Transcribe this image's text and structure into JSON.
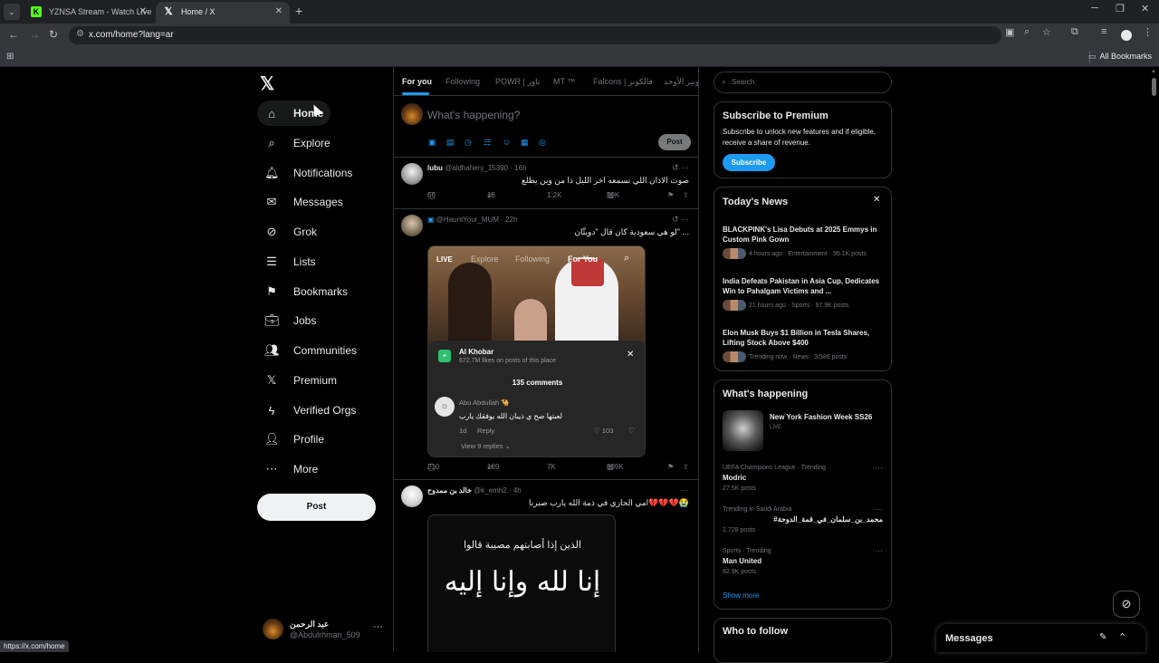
{
  "browser": {
    "tabs": [
      {
        "title": "YZNSA Stream - Watch Live on",
        "favicon": "K",
        "close": "✕"
      },
      {
        "title": "Home / X",
        "favicon": "𝕏",
        "close": "✕"
      }
    ],
    "new_tab": "+",
    "window": {
      "minimize": "─",
      "restore": "❐",
      "close": "✕"
    },
    "url": "x.com/home?lang=ar",
    "bookmarks": {
      "all_label": "All Bookmarks"
    },
    "status_url": "https://x.com/home"
  },
  "nav": {
    "logo": "𝕏",
    "items": [
      {
        "label": "Home",
        "icon": "⌂"
      },
      {
        "label": "Explore",
        "icon": "⌕"
      },
      {
        "label": "Notifications",
        "icon": "🔔︎"
      },
      {
        "label": "Messages",
        "icon": "✉"
      },
      {
        "label": "Grok",
        "icon": "⊘"
      },
      {
        "label": "Lists",
        "icon": "☰"
      },
      {
        "label": "Bookmarks",
        "icon": "⚑"
      },
      {
        "label": "Jobs",
        "icon": "💼︎"
      },
      {
        "label": "Communities",
        "icon": "👥︎"
      },
      {
        "label": "Premium",
        "icon": "𝕏"
      },
      {
        "label": "Verified Orgs",
        "icon": "ϟ"
      },
      {
        "label": "Profile",
        "icon": "👤︎"
      },
      {
        "label": "More",
        "icon": "⋯"
      }
    ],
    "post_button": "Post",
    "account": {
      "name": "عبد الرحمن",
      "handle": "@Abdulrhman_509",
      "more": "···"
    }
  },
  "timeline": {
    "tabs": [
      "For you",
      "Following",
      "POWR | باور",
      "MT ™",
      "Falcons | فالكونز",
      "بوبير الأوحد"
    ],
    "active_tab": "For you",
    "composer": {
      "placeholder": "What's happening?",
      "post_label": "Post",
      "tool_icons": [
        "▣",
        "▤",
        "◷",
        "☷",
        "☺",
        "▦",
        "◎"
      ]
    },
    "tweets": [
      {
        "name": "lubu",
        "handle": "@aldhahery_15390",
        "time": "16h",
        "text": "صوت الاذان اللي تسمعه اخر الليل ذا من وين يطلع",
        "replies": "66",
        "reposts": "13",
        "likes": "1.2K",
        "views": "59K"
      },
      {
        "name": "",
        "handle": "@HauntYour_MUM",
        "time": "22h",
        "text": "لو هي سعودية كان قال \"دويتَّان\" ...",
        "replies": "210",
        "reposts": "189",
        "likes": "7K",
        "views": "699K",
        "media": {
          "live": "LIVE",
          "tabs": [
            "Explore",
            "Following",
            "For You"
          ],
          "place": "Al Khobar",
          "place_likes": "672.7M likes on posts of this place",
          "comments_count": "135 comments",
          "comment": {
            "name": "Abu Abdullah 🐪",
            "text": "لعبتها صح ي ذيبان الله يوفقك يارب",
            "age": "1d",
            "reply": "Reply",
            "likes": "103",
            "view_replies": "View 9 replies ⌄"
          }
        }
      },
      {
        "name": "خالد بن ممدوح",
        "handle": "@k_emh2",
        "time": "4h",
        "text": "امي الحازي في ذمة الله يارب صبرنا💔💔💔😭",
        "media": {
          "line1": "الذين إذا أصابتهم مصيبة قالوا",
          "line2": "إنا لله وإنا إليه"
        }
      }
    ]
  },
  "sidebar": {
    "search_placeholder": "Search",
    "premium": {
      "title": "Subscribe to Premium",
      "text": "Subscribe to unlock new features and if eligible, receive a share of revenue.",
      "button": "Subscribe"
    },
    "news": {
      "title": "Today's News",
      "items": [
        {
          "headline": "BLACKPINK's Lisa Debuts at 2025 Emmys in Custom Pink Gown",
          "meta": "4 hours ago · Entertainment · 95.1K posts"
        },
        {
          "headline": "India Defeats Pakistan in Asia Cup, Dedicates Win to Pahalgam Victims and ...",
          "meta": "21 hours ago · Sports · 97.9K posts"
        },
        {
          "headline": "Elon Musk Buys $1 Billion in Tesla Shares, Lifting Stock Above $400",
          "meta": "Trending now · News · 3,586 posts"
        }
      ]
    },
    "happening": {
      "title": "What's happening",
      "event": {
        "title": "New York Fashion Week SS26",
        "status": "LIVE"
      },
      "trends": [
        {
          "context": "UEFA Champions League · Trending",
          "name": "Modric",
          "count": "27.5K posts"
        },
        {
          "context": "Trending in Saudi Arabia",
          "name": "#محمد_بن_سلمان_في_قمة_الدوحة",
          "count": "2,728 posts"
        },
        {
          "context": "Sports · Trending",
          "name": "Man United",
          "count": "82.9K posts"
        }
      ],
      "show_more": "Show more"
    },
    "who_to_follow": {
      "title": "Who to follow"
    }
  },
  "messages_drawer": {
    "title": "Messages",
    "compose_icon": "✎",
    "collapse_icon": "⌃"
  }
}
